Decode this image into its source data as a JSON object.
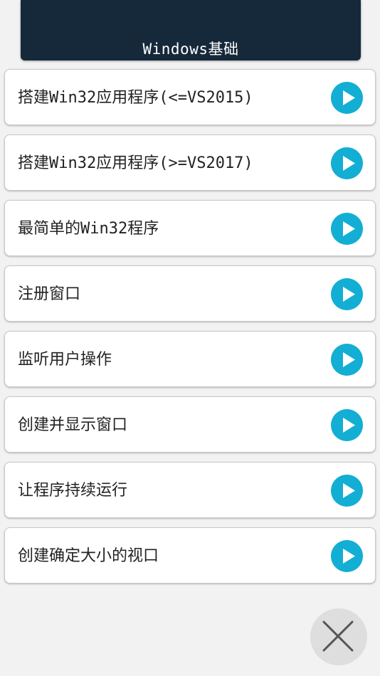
{
  "header": {
    "title": "Windows基础"
  },
  "items": [
    {
      "label": "搭建Win32应用程序(<=VS2015)"
    },
    {
      "label": "搭建Win32应用程序(>=VS2017)"
    },
    {
      "label": "最简单的Win32程序"
    },
    {
      "label": "注册窗口"
    },
    {
      "label": "监听用户操作"
    },
    {
      "label": "创建并显示窗口"
    },
    {
      "label": "让程序持续运行"
    },
    {
      "label": "创建确定大小的视口"
    }
  ],
  "colors": {
    "header_bg": "#16293a",
    "accent": "#13aed3",
    "page_bg": "#f2f2f2"
  },
  "icons": {
    "item_action": "play-icon",
    "close": "close-icon"
  }
}
